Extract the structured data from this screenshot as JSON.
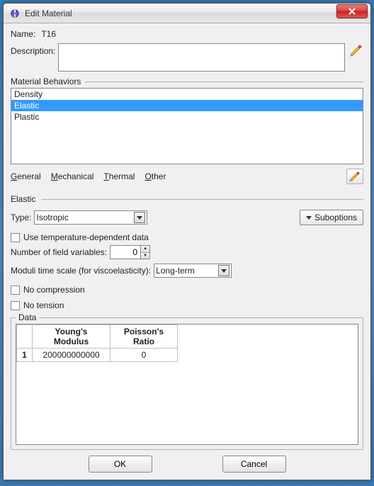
{
  "window": {
    "title": "Edit Material"
  },
  "name": {
    "label": "Name:",
    "value": "T16"
  },
  "description": {
    "label": "Description:",
    "value": ""
  },
  "behaviors": {
    "label": "Material Behaviors",
    "items": [
      "Density",
      "Elastic",
      "Plastic"
    ],
    "selected_index": 1
  },
  "menus": {
    "general": "General",
    "mechanical": "Mechanical",
    "thermal": "Thermal",
    "other": "Other"
  },
  "elastic": {
    "title": "Elastic",
    "type_label": "Type:",
    "type_value": "Isotropic",
    "suboptions_label": "Suboptions",
    "use_temp_label": "Use temperature-dependent data",
    "num_vars_label": "Number of field variables:",
    "num_vars_value": "0",
    "moduli_label": "Moduli time scale (for viscoelasticity):",
    "moduli_value": "Long-term",
    "no_compression_label": "No compression",
    "no_tension_label": "No tension"
  },
  "data_group": {
    "label": "Data",
    "headers": {
      "ym": "Young's\nModulus",
      "pr": "Poisson's\nRatio"
    },
    "rows": [
      {
        "idx": "1",
        "ym": "200000000000",
        "pr": "0"
      }
    ]
  },
  "buttons": {
    "ok": "OK",
    "cancel": "Cancel"
  }
}
